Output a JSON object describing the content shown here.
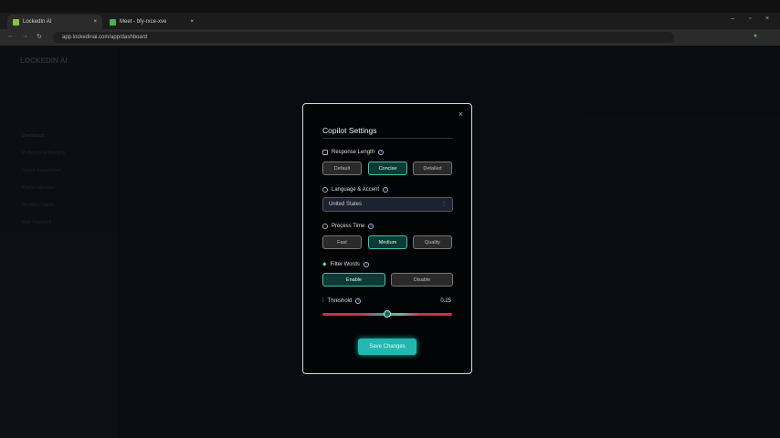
{
  "browser": {
    "tabs": [
      {
        "label": "LockedIn AI"
      },
      {
        "label": "Meet - bfy-rxce-xve"
      }
    ],
    "url": "app.lockedinai.com/app/dashboard"
  },
  "app": {
    "logo": "LOCKEDIN AI",
    "sidebar": [
      "Dashboard",
      "Professional Meeting",
      "Coach Assessment",
      "Phone Interview",
      "Meeting Copilot",
      "Role Playbook"
    ]
  },
  "modal": {
    "title": "Copilot Settings",
    "response_length": {
      "label": "Response Length",
      "options": [
        "Default",
        "Concise",
        "Detailed"
      ],
      "selected": "Concise"
    },
    "language": {
      "label": "Language & Accent",
      "value": "United States"
    },
    "process_time": {
      "label": "Process Time",
      "options": [
        "Fast",
        "Medium",
        "Quality"
      ],
      "selected": "Medium"
    },
    "filter_words": {
      "label": "Filter Words",
      "options": [
        "Enable",
        "Disable"
      ],
      "selected": "Enable"
    },
    "threshold": {
      "label": "Threshold",
      "value": "0.25",
      "slider_min": 0,
      "slider_max": 0.5,
      "slider_value": 0.25
    },
    "save_label": "Save Changes",
    "close": "×"
  },
  "colors": {
    "accent": "#22b8b0",
    "selected_border": "#3fc1b0",
    "slider_red": "#c8304f"
  }
}
